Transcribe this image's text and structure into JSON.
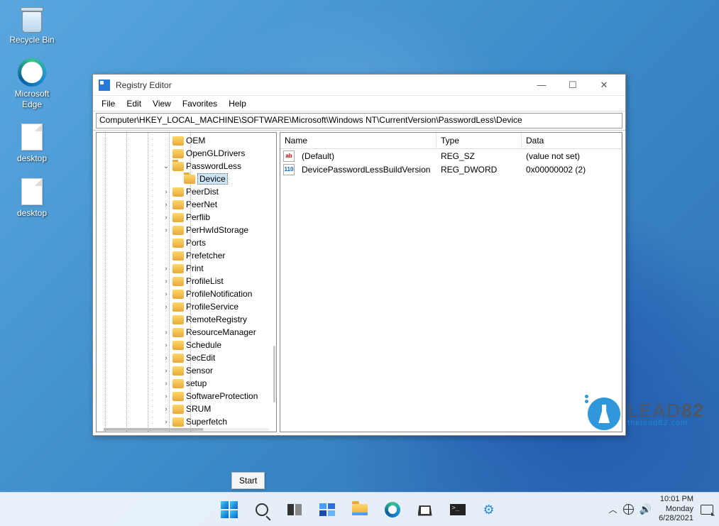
{
  "desktop": {
    "icons": [
      {
        "label": "Recycle Bin",
        "kind": "bin"
      },
      {
        "label": "Microsoft Edge",
        "kind": "edge"
      },
      {
        "label": "desktop",
        "kind": "file"
      },
      {
        "label": "desktop",
        "kind": "file"
      }
    ]
  },
  "window": {
    "title": "Registry Editor",
    "menu": [
      "File",
      "Edit",
      "View",
      "Favorites",
      "Help"
    ],
    "address": "Computer\\HKEY_LOCAL_MACHINE\\SOFTWARE\\Microsoft\\Windows NT\\CurrentVersion\\PasswordLess\\Device",
    "tree": [
      {
        "label": "OEM",
        "expander": "",
        "indent": 0
      },
      {
        "label": "OpenGLDrivers",
        "expander": "",
        "indent": 0
      },
      {
        "label": "PasswordLess",
        "expander": "v",
        "indent": 0,
        "open": true
      },
      {
        "label": "Device",
        "expander": "",
        "indent": 1,
        "selected": true,
        "open": true
      },
      {
        "label": "PeerDist",
        "expander": ">",
        "indent": 0
      },
      {
        "label": "PeerNet",
        "expander": ">",
        "indent": 0
      },
      {
        "label": "Perflib",
        "expander": ">",
        "indent": 0
      },
      {
        "label": "PerHwIdStorage",
        "expander": ">",
        "indent": 0
      },
      {
        "label": "Ports",
        "expander": "",
        "indent": 0
      },
      {
        "label": "Prefetcher",
        "expander": "",
        "indent": 0
      },
      {
        "label": "Print",
        "expander": ">",
        "indent": 0
      },
      {
        "label": "ProfileList",
        "expander": ">",
        "indent": 0
      },
      {
        "label": "ProfileNotification",
        "expander": ">",
        "indent": 0
      },
      {
        "label": "ProfileService",
        "expander": ">",
        "indent": 0
      },
      {
        "label": "RemoteRegistry",
        "expander": "",
        "indent": 0
      },
      {
        "label": "ResourceManager",
        "expander": ">",
        "indent": 0
      },
      {
        "label": "Schedule",
        "expander": ">",
        "indent": 0
      },
      {
        "label": "SecEdit",
        "expander": ">",
        "indent": 0
      },
      {
        "label": "Sensor",
        "expander": ">",
        "indent": 0
      },
      {
        "label": "setup",
        "expander": ">",
        "indent": 0
      },
      {
        "label": "SoftwareProtection",
        "expander": ">",
        "indent": 0
      },
      {
        "label": "SRUM",
        "expander": ">",
        "indent": 0
      },
      {
        "label": "Superfetch",
        "expander": ">",
        "indent": 0
      }
    ],
    "list": {
      "columns": [
        "Name",
        "Type",
        "Data"
      ],
      "rows": [
        {
          "icon": "str",
          "name": "(Default)",
          "type": "REG_SZ",
          "data": "(value not set)"
        },
        {
          "icon": "dword",
          "name": "DevicePasswordLessBuildVersion",
          "type": "REG_DWORD",
          "data": "0x00000002 (2)"
        }
      ]
    }
  },
  "watermark": {
    "brand_a": "LEAD",
    "brand_b": "82",
    "url": "thelead82.com"
  },
  "tooltip": {
    "start": "Start"
  },
  "systray": {
    "time": "10:01 PM",
    "day": "Monday",
    "date": "6/28/2021"
  }
}
